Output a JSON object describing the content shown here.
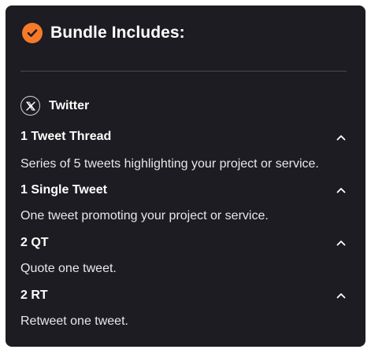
{
  "header": {
    "title": "Bundle Includes:"
  },
  "platform": {
    "name": "Twitter",
    "icon": "x-logo-icon"
  },
  "items": [
    {
      "title": "1 Tweet Thread",
      "description": "Series of 5 tweets highlighting your project or service.",
      "expanded": true
    },
    {
      "title": "1 Single Tweet",
      "description": "One tweet promoting your project or service.",
      "expanded": true
    },
    {
      "title": "2 QT",
      "description": "Quote one tweet.",
      "expanded": true
    },
    {
      "title": "2 RT",
      "description": "Retweet one tweet.",
      "expanded": true
    }
  ],
  "colors": {
    "card_background": "#1c1c22",
    "accent": "#f7792a",
    "text": "#ffffff",
    "divider": "#4a4a52"
  }
}
